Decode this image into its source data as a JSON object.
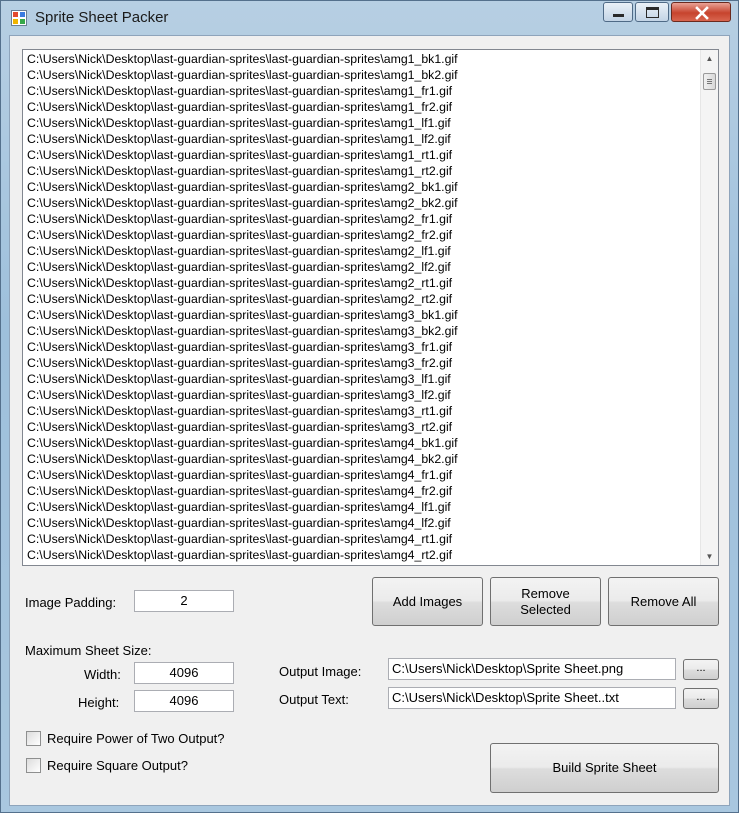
{
  "window": {
    "title": "Sprite Sheet Packer"
  },
  "files": [
    "C:\\Users\\Nick\\Desktop\\last-guardian-sprites\\last-guardian-sprites\\amg1_bk1.gif",
    "C:\\Users\\Nick\\Desktop\\last-guardian-sprites\\last-guardian-sprites\\amg1_bk2.gif",
    "C:\\Users\\Nick\\Desktop\\last-guardian-sprites\\last-guardian-sprites\\amg1_fr1.gif",
    "C:\\Users\\Nick\\Desktop\\last-guardian-sprites\\last-guardian-sprites\\amg1_fr2.gif",
    "C:\\Users\\Nick\\Desktop\\last-guardian-sprites\\last-guardian-sprites\\amg1_lf1.gif",
    "C:\\Users\\Nick\\Desktop\\last-guardian-sprites\\last-guardian-sprites\\amg1_lf2.gif",
    "C:\\Users\\Nick\\Desktop\\last-guardian-sprites\\last-guardian-sprites\\amg1_rt1.gif",
    "C:\\Users\\Nick\\Desktop\\last-guardian-sprites\\last-guardian-sprites\\amg1_rt2.gif",
    "C:\\Users\\Nick\\Desktop\\last-guardian-sprites\\last-guardian-sprites\\amg2_bk1.gif",
    "C:\\Users\\Nick\\Desktop\\last-guardian-sprites\\last-guardian-sprites\\amg2_bk2.gif",
    "C:\\Users\\Nick\\Desktop\\last-guardian-sprites\\last-guardian-sprites\\amg2_fr1.gif",
    "C:\\Users\\Nick\\Desktop\\last-guardian-sprites\\last-guardian-sprites\\amg2_fr2.gif",
    "C:\\Users\\Nick\\Desktop\\last-guardian-sprites\\last-guardian-sprites\\amg2_lf1.gif",
    "C:\\Users\\Nick\\Desktop\\last-guardian-sprites\\last-guardian-sprites\\amg2_lf2.gif",
    "C:\\Users\\Nick\\Desktop\\last-guardian-sprites\\last-guardian-sprites\\amg2_rt1.gif",
    "C:\\Users\\Nick\\Desktop\\last-guardian-sprites\\last-guardian-sprites\\amg2_rt2.gif",
    "C:\\Users\\Nick\\Desktop\\last-guardian-sprites\\last-guardian-sprites\\amg3_bk1.gif",
    "C:\\Users\\Nick\\Desktop\\last-guardian-sprites\\last-guardian-sprites\\amg3_bk2.gif",
    "C:\\Users\\Nick\\Desktop\\last-guardian-sprites\\last-guardian-sprites\\amg3_fr1.gif",
    "C:\\Users\\Nick\\Desktop\\last-guardian-sprites\\last-guardian-sprites\\amg3_fr2.gif",
    "C:\\Users\\Nick\\Desktop\\last-guardian-sprites\\last-guardian-sprites\\amg3_lf1.gif",
    "C:\\Users\\Nick\\Desktop\\last-guardian-sprites\\last-guardian-sprites\\amg3_lf2.gif",
    "C:\\Users\\Nick\\Desktop\\last-guardian-sprites\\last-guardian-sprites\\amg3_rt1.gif",
    "C:\\Users\\Nick\\Desktop\\last-guardian-sprites\\last-guardian-sprites\\amg3_rt2.gif",
    "C:\\Users\\Nick\\Desktop\\last-guardian-sprites\\last-guardian-sprites\\amg4_bk1.gif",
    "C:\\Users\\Nick\\Desktop\\last-guardian-sprites\\last-guardian-sprites\\amg4_bk2.gif",
    "C:\\Users\\Nick\\Desktop\\last-guardian-sprites\\last-guardian-sprites\\amg4_fr1.gif",
    "C:\\Users\\Nick\\Desktop\\last-guardian-sprites\\last-guardian-sprites\\amg4_fr2.gif",
    "C:\\Users\\Nick\\Desktop\\last-guardian-sprites\\last-guardian-sprites\\amg4_lf1.gif",
    "C:\\Users\\Nick\\Desktop\\last-guardian-sprites\\last-guardian-sprites\\amg4_lf2.gif",
    "C:\\Users\\Nick\\Desktop\\last-guardian-sprites\\last-guardian-sprites\\amg4_rt1.gif",
    "C:\\Users\\Nick\\Desktop\\last-guardian-sprites\\last-guardian-sprites\\amg4_rt2.gif"
  ],
  "padding": {
    "label": "Image Padding:",
    "value": "2"
  },
  "buttons": {
    "add_images": "Add Images",
    "remove_selected": "Remove Selected",
    "remove_all": "Remove All",
    "build": "Build Sprite Sheet",
    "browse": "..."
  },
  "sheet_size": {
    "label": "Maximum Sheet Size:",
    "width_label": "Width:",
    "width_value": "4096",
    "height_label": "Height:",
    "height_value": "4096"
  },
  "output": {
    "image_label": "Output Image:",
    "image_value": "C:\\Users\\Nick\\Desktop\\Sprite Sheet.png",
    "text_label": "Output Text:",
    "text_value": "C:\\Users\\Nick\\Desktop\\Sprite Sheet..txt"
  },
  "options": {
    "power_of_two": {
      "label": "Require Power of Two Output?",
      "checked": false
    },
    "square": {
      "label": "Require Square Output?",
      "checked": false
    }
  },
  "icons": {
    "app": "app-window-icon",
    "minimize": "minimize-icon",
    "maximize": "maximize-icon",
    "close": "close-icon",
    "scroll_up": "scroll-up-arrow-icon",
    "scroll_down": "scroll-down-arrow-icon"
  },
  "colors": {
    "close_button": "#c7442e",
    "window_frame": "#9ec0dc",
    "client_bg": "#f0f0f0"
  }
}
